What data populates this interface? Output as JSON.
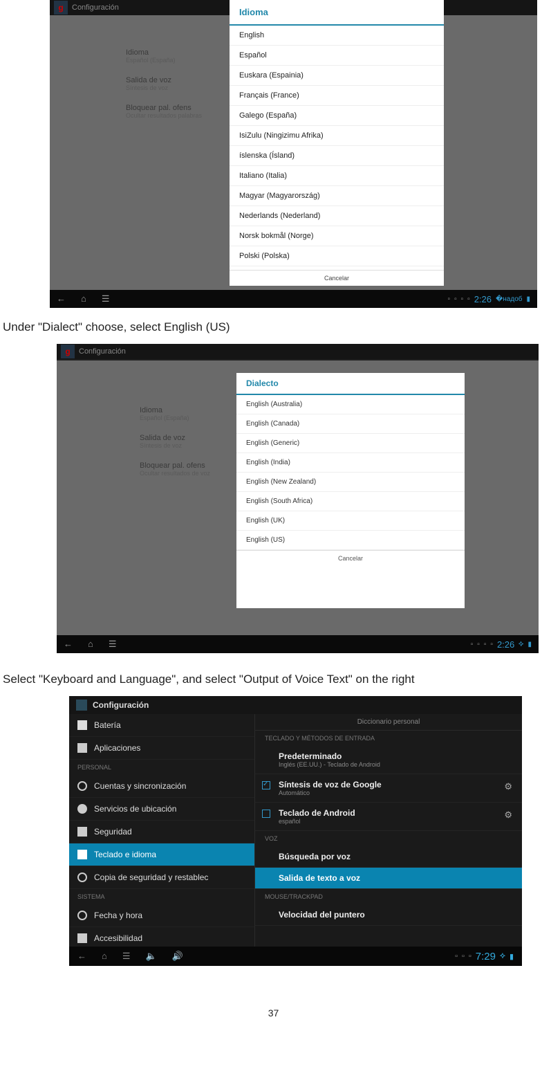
{
  "shot1": {
    "topbar_title": "Configuración",
    "left_items": [
      {
        "t": "Idioma",
        "s": "Español (España)"
      },
      {
        "t": "Salida de voz",
        "s": "Síntesis de voz"
      },
      {
        "t": "Bloquear pal. ofens",
        "s": "Ocultar resultados palabras"
      }
    ],
    "dialog_title": "Idioma",
    "dialog_items": [
      "English",
      "Español",
      "Euskara (Espainia)",
      "Français (France)",
      "Galego (España)",
      "IsiZulu (Ningizimu Afrika)",
      "íslenska (Ísland)",
      "Italiano (Italia)",
      "Magyar (Magyarország)",
      "Nederlands (Nederland)",
      "Norsk bokmål (Norge)",
      "Polski (Polska)"
    ],
    "cancel": "Cancelar",
    "clock": "2:26"
  },
  "caption1": "Under \"Dialect\" choose, select English (US)",
  "shot2": {
    "topbar_title": "Configuración",
    "left_items": [
      {
        "t": "Idioma",
        "s": "Español (España)"
      },
      {
        "t": "Salida de voz",
        "s": "Síntesis de voz"
      },
      {
        "t": "Bloquear pal. ofens",
        "s": "Ocultar resultados de voz"
      }
    ],
    "dialog_title": "Dialecto",
    "dialog_items": [
      "English (Australia)",
      "English (Canada)",
      "English (Generic)",
      "English (India)",
      "English (New Zealand)",
      "English (South Africa)",
      "English (UK)",
      "English (US)"
    ],
    "cancel": "Cancelar",
    "clock": "2:26"
  },
  "caption2": "Select \"Keyboard and Language\", and select \"Output of Voice Text\" on the right",
  "shot3": {
    "topbar_title": "Configuración",
    "left": {
      "items_top": [
        {
          "label": "Batería",
          "ico": "i-bat"
        },
        {
          "label": "Aplicaciones",
          "ico": "i-app"
        }
      ],
      "header1": "PERSONAL",
      "items_mid": [
        {
          "label": "Cuentas y sincronización",
          "ico": "i-sync"
        },
        {
          "label": "Servicios de ubicación",
          "ico": "i-loc"
        },
        {
          "label": "Seguridad",
          "ico": "i-sec"
        },
        {
          "label": "Teclado e idioma",
          "ico": "i-key",
          "selected": true
        },
        {
          "label": "Copia de seguridad y restablec",
          "ico": "i-bak"
        }
      ],
      "header2": "SISTEMA",
      "items_bot": [
        {
          "label": "Fecha y hora",
          "ico": "i-clk"
        },
        {
          "label": "Accesibilidad",
          "ico": "i-acc"
        }
      ]
    },
    "right": {
      "prev": "Diccionario personal",
      "head1": "TECLADO Y MÉTODOS DE ENTRADA",
      "items1": [
        {
          "t": "Predeterminado",
          "s": "Inglés (EE.UU.) - Teclado de Android"
        },
        {
          "t": "Síntesis de voz de Google",
          "s": "Automático",
          "chk": true,
          "gear": true
        },
        {
          "t": "Teclado de Android",
          "s": "español",
          "gear": true
        }
      ],
      "head2": "VOZ",
      "items2": [
        {
          "t": "Búsqueda por voz"
        },
        {
          "t": "Salida de texto a voz",
          "selected": true
        }
      ],
      "head3": "MOUSE/TRACKPAD",
      "items3": [
        {
          "t": "Velocidad del puntero"
        }
      ]
    },
    "clock": "7:29"
  },
  "page_number": "37"
}
